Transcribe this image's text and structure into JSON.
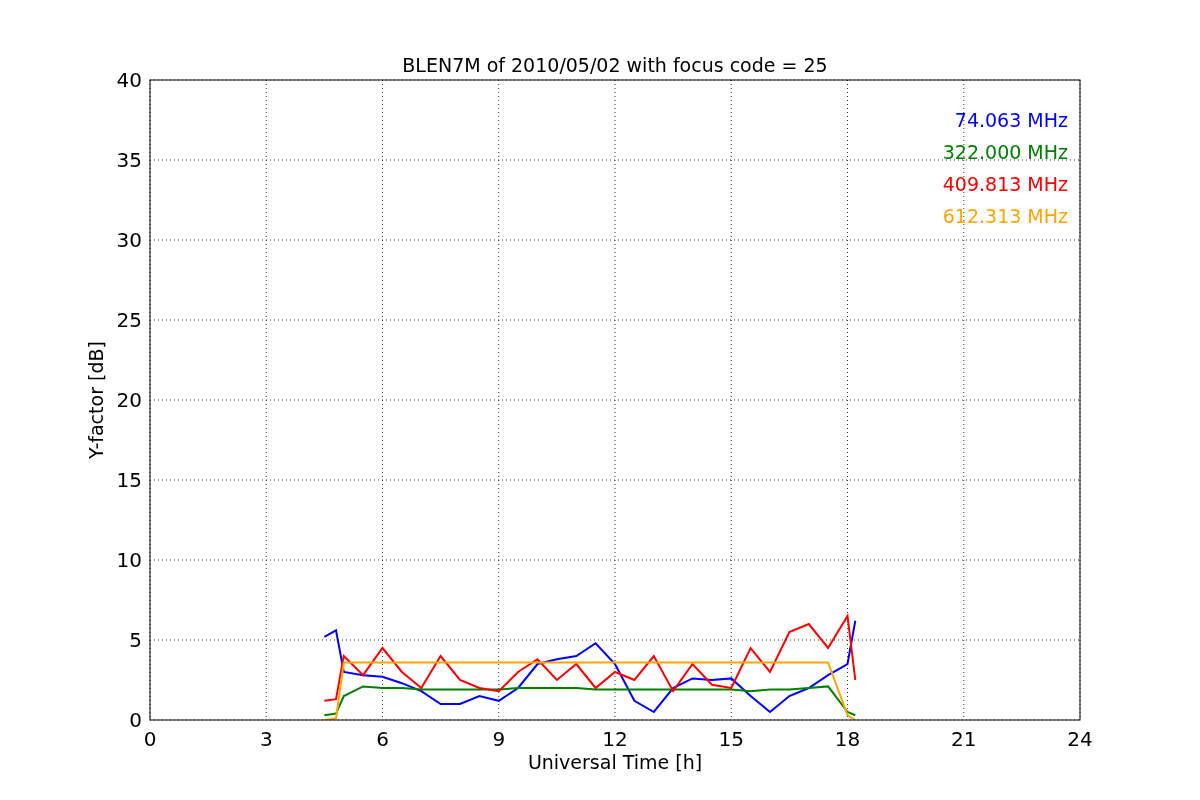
{
  "chart_data": {
    "type": "line",
    "title": "BLEN7M of 2010/05/02 with focus code = 25",
    "xlabel": "Universal Time [h]",
    "ylabel": "Y-factor [dB]",
    "x": [
      4.5,
      4.8,
      5.0,
      5.5,
      6,
      6.5,
      7,
      7.5,
      8,
      8.5,
      9,
      9.5,
      10,
      10.5,
      11,
      11.5,
      12,
      12.5,
      13,
      13.5,
      14,
      14.5,
      15,
      15.5,
      16,
      16.5,
      17,
      17.5,
      18,
      18.2
    ],
    "series": [
      {
        "name": "74.063 MHz",
        "color": "#0000ff",
        "values": [
          5.2,
          5.6,
          3.0,
          2.8,
          2.7,
          2.3,
          1.8,
          1.0,
          1.0,
          1.5,
          1.2,
          2.0,
          3.5,
          3.8,
          4.0,
          4.8,
          3.5,
          1.2,
          0.5,
          2.0,
          2.6,
          2.5,
          2.6,
          1.5,
          0.5,
          1.5,
          2.0,
          2.8,
          3.5,
          6.2
        ]
      },
      {
        "name": "322.000 MHz",
        "color": "#008000",
        "values": [
          0.3,
          0.4,
          1.5,
          2.1,
          2.0,
          2.0,
          1.9,
          1.9,
          1.9,
          1.9,
          1.9,
          2.0,
          2.0,
          2.0,
          2.0,
          1.9,
          1.9,
          1.9,
          1.9,
          1.9,
          1.9,
          1.9,
          1.9,
          1.8,
          1.9,
          1.9,
          2.0,
          2.1,
          0.5,
          0.3
        ]
      },
      {
        "name": "409.813 MHz",
        "color": "#ff0000",
        "values": [
          1.2,
          1.3,
          4.0,
          2.8,
          4.5,
          3.0,
          2.0,
          4.0,
          2.5,
          2.0,
          1.8,
          3.0,
          3.8,
          2.5,
          3.5,
          2.0,
          3.0,
          2.5,
          4.0,
          1.8,
          3.5,
          2.2,
          2.0,
          4.5,
          3.0,
          5.5,
          6.0,
          4.5,
          6.5,
          2.5
        ]
      },
      {
        "name": "612.313 MHz",
        "color": "#ffa500",
        "values": [
          0.0,
          0.1,
          3.6,
          3.6,
          3.6,
          3.6,
          3.6,
          3.6,
          3.6,
          3.6,
          3.6,
          3.6,
          3.6,
          3.6,
          3.6,
          3.6,
          3.6,
          3.6,
          3.6,
          3.6,
          3.6,
          3.6,
          3.6,
          3.6,
          3.6,
          3.6,
          3.6,
          3.6,
          0.3,
          0.0
        ]
      }
    ],
    "grid": true,
    "xlim": [
      0,
      24
    ],
    "ylim": [
      0,
      40
    ],
    "xticks": [
      0,
      3,
      6,
      9,
      12,
      15,
      18,
      21,
      24
    ],
    "yticks": [
      0,
      5,
      10,
      15,
      20,
      25,
      30,
      35,
      40
    ]
  }
}
